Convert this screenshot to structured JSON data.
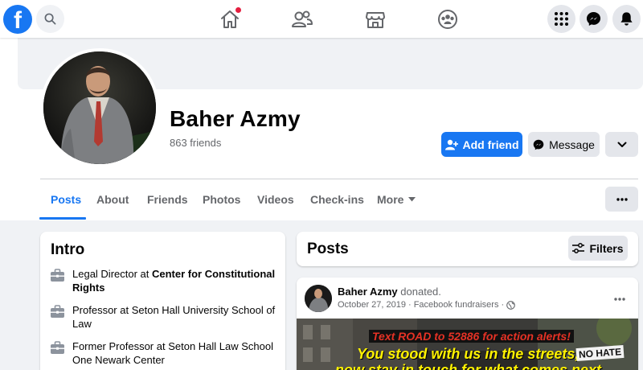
{
  "topbar": {
    "logo_letter": "f",
    "nav_icons": [
      "home-icon",
      "friends-icon",
      "marketplace-icon",
      "groups-icon"
    ],
    "right_icons": [
      "menu-grid-icon",
      "messenger-icon",
      "notifications-bell-icon"
    ],
    "home_notification_color": "#e41e3f"
  },
  "profile": {
    "name": "Baher Azmy",
    "friends_count": "863 friends",
    "add_friend_label": "Add friend",
    "message_label": "Message"
  },
  "tabs": [
    {
      "label": "Posts",
      "active": true
    },
    {
      "label": "About"
    },
    {
      "label": "Friends"
    },
    {
      "label": "Photos"
    },
    {
      "label": "Videos"
    },
    {
      "label": "Check-ins"
    },
    {
      "label": "More"
    }
  ],
  "intro": {
    "title": "Intro",
    "items": [
      {
        "prefix": "Legal Director at ",
        "bold": "Center for Constitutional Rights",
        "icon": "briefcase-icon"
      },
      {
        "prefix": "Professor at Seton Hall University School of Law",
        "bold": "",
        "icon": "briefcase-icon"
      },
      {
        "prefix": "Former Professor at Seton Hall Law School One Newark Center",
        "bold": "",
        "icon": "briefcase-icon"
      }
    ]
  },
  "posts": {
    "title": "Posts",
    "filters_label": "Filters"
  },
  "post": {
    "author": "Baher Azmy",
    "action": "donated.",
    "date": "October 27, 2019",
    "separator": "·",
    "source": "Facebook fundraisers",
    "privacy_icon": "globe-icon",
    "banner_line1": "Text ROAD to 52886 for action alerts!",
    "banner_line2": "You stood with us in the streets,",
    "banner_line3": "now stay in touch for what comes next",
    "sign_text": "NO HATE"
  },
  "colors": {
    "brand": "#1877f2",
    "background": "#f0f2f5",
    "secondary_text": "#65676b",
    "button_gray": "#e4e6eb"
  }
}
